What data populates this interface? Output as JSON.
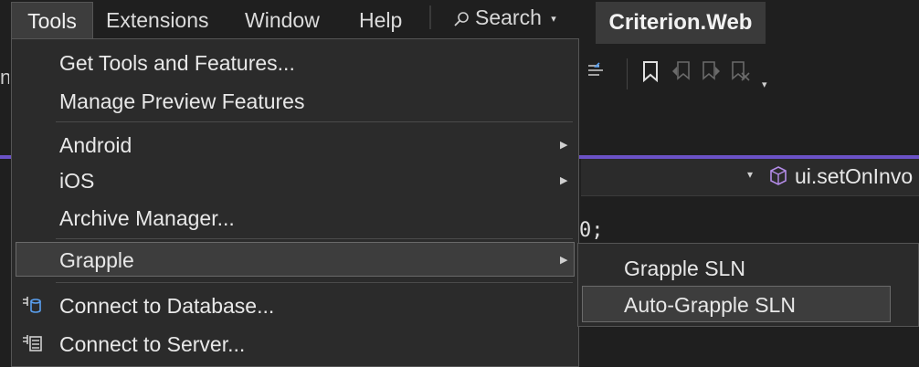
{
  "menubar": {
    "items": [
      "Tools",
      "Extensions",
      "Window",
      "Help"
    ],
    "search_label": "Search",
    "title": "Criterion.Web"
  },
  "editor": {
    "member_combo_label": "ui.setOnInvo",
    "code_fragment": "0;"
  },
  "tools_menu": {
    "items": [
      {
        "label": "Get Tools and Features..."
      },
      {
        "label": "Manage Preview Features"
      },
      {
        "label": "Android"
      },
      {
        "label": "iOS"
      },
      {
        "label": "Archive Manager..."
      },
      {
        "label": "Grapple"
      },
      {
        "label": "Connect to Database..."
      },
      {
        "label": "Connect to Server..."
      }
    ]
  },
  "grapple_submenu": {
    "items": [
      {
        "label": "Grapple SLN"
      },
      {
        "label": "Auto-Grapple SLN"
      }
    ]
  }
}
